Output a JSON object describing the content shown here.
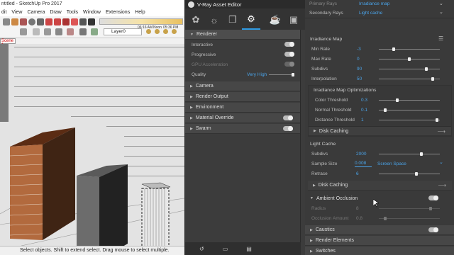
{
  "sketchup": {
    "title": "ntitled - SketchUp Pro 2017",
    "menu": [
      "dit",
      "View",
      "Camera",
      "Draw",
      "Tools",
      "Window",
      "Extensions",
      "Help"
    ],
    "toolbar_time1": "06:16 AM",
    "toolbar_time2": "Noon",
    "toolbar_time3": "05:36 PM",
    "layer": "Layer0",
    "scene_tab": "Scene 1",
    "status": "Select objects. Shift to extend select. Drag mouse to select multiple."
  },
  "vray": {
    "title": "V-Ray Asset Editor",
    "tabs": [
      "render-elements-icon",
      "light-icon",
      "geometry-icon",
      "settings-icon",
      "teapot-icon",
      "frame-buffer-icon"
    ],
    "renderer": {
      "label": "Renderer",
      "interactive": "Interactive",
      "progressive": "Progressive",
      "gpu": "GPU Acceleration",
      "quality_label": "Quality",
      "quality_value": "Very High"
    },
    "left_sections": [
      "Camera",
      "Render Output",
      "Environment",
      "Material Override",
      "Swarm"
    ],
    "bottom_icons": [
      "reset-icon",
      "open-icon",
      "save-icon"
    ],
    "right": {
      "primary_rays_label": "Primary Rays",
      "primary_rays_value": "Irradiance map",
      "secondary_rays_label": "Secondary Rays",
      "secondary_rays_value": "Light cache",
      "irradiance_map": {
        "title": "Irradiance Map",
        "min_rate_label": "Min Rate",
        "min_rate": "-3",
        "min_rate_fraction": 0.24,
        "max_rate_label": "Max Rate",
        "max_rate": "0",
        "max_rate_fraction": 0.5,
        "subdivs_label": "Subdivs",
        "subdivs": "90",
        "subdivs_fraction": 0.78,
        "interpolation_label": "Interpolation",
        "interpolation": "50",
        "interpolation_fraction": 0.88
      },
      "optimizations": {
        "title": "Irradiance Map Optimizations",
        "color_threshold_label": "Color Threshold",
        "color_threshold": "0.3",
        "color_threshold_fraction": 0.3,
        "normal_threshold_label": "Normal Threshold",
        "normal_threshold": "0.1",
        "normal_threshold_fraction": 0.1,
        "distance_threshold_label": "Distance Threshold",
        "distance_threshold": "1",
        "distance_threshold_fraction": 0.95
      },
      "disk_caching_1": "Disk Caching",
      "light_cache": {
        "title": "Light Cache",
        "subdivs_label": "Subdivs",
        "subdivs": "2000",
        "subdivs_fraction": 0.7,
        "sample_size_label": "Sample Size",
        "sample_size": "0.008",
        "sample_size_mode": "Screen Space",
        "retrace_label": "Retrace",
        "retrace": "6",
        "retrace_fraction": 0.62
      },
      "disk_caching_2": "Disk Caching",
      "ambient_occlusion": {
        "title": "Ambient Occlusion",
        "radius_label": "Radius",
        "radius": "8",
        "radius_fraction": 0.85,
        "amount_label": "Occlusion Amount",
        "amount": "0.8",
        "amount_fraction": 0.1
      },
      "bottom_sections": [
        "Caustics",
        "Render Elements",
        "Switches"
      ]
    }
  }
}
